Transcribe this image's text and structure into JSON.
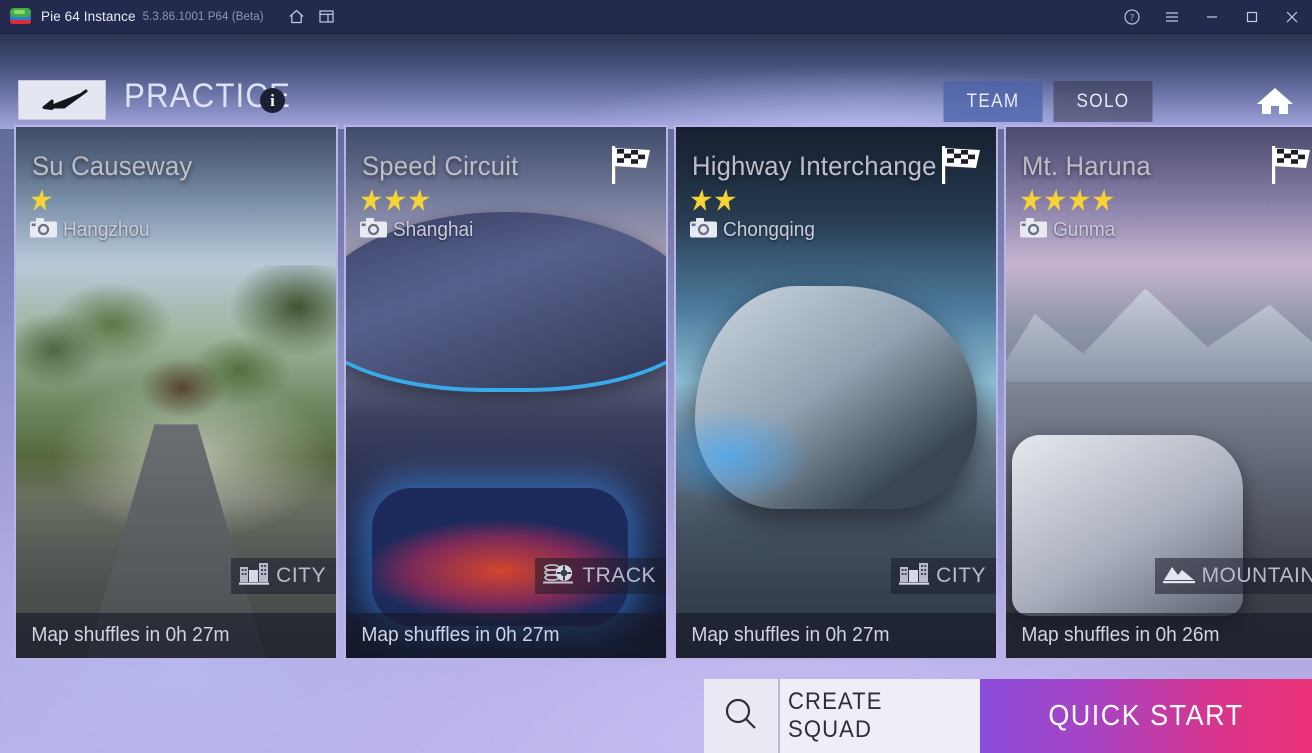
{
  "titlebar": {
    "app_name": "Pie 64 Instance",
    "version": "5.3.86.1001 P64 (Beta)",
    "icons": {
      "logo": "bluestacks-logo",
      "home": "home-icon",
      "multi_instance": "multi-instance-icon",
      "help": "help-icon",
      "menu": "hamburger-menu-icon",
      "minimize": "minimize-icon",
      "maximize": "maximize-icon",
      "close": "close-icon"
    }
  },
  "header": {
    "back_label": "back-arrow",
    "title": "PRACTICE",
    "info_label": "i",
    "tabs": [
      {
        "label": "TEAM",
        "active": true
      },
      {
        "label": "SOLO",
        "active": false
      }
    ],
    "home_label": "home-icon"
  },
  "cards": [
    {
      "title": "Su Causeway",
      "stars": 1,
      "location": "Hangzhou",
      "type": "CITY",
      "type_icon": "city-buildings-icon",
      "shuffle": "Map shuffles in 0h 27m",
      "has_flag": false,
      "art": "art-su"
    },
    {
      "title": "Speed Circuit",
      "stars": 3,
      "location": "Shanghai",
      "type": "TRACK",
      "type_icon": "tire-track-icon",
      "shuffle": "Map shuffles in 0h 27m",
      "has_flag": true,
      "art": "art-speed"
    },
    {
      "title": "Highway Interchange",
      "stars": 2,
      "location": "Chongqing",
      "type": "CITY",
      "type_icon": "city-buildings-icon",
      "shuffle": "Map shuffles in 0h 27m",
      "has_flag": true,
      "art": "art-hwy"
    },
    {
      "title": "Mt. Haruna",
      "stars": 4,
      "location": "Gunma",
      "type": "MOUNTAIN",
      "type_icon": "mountain-icon",
      "shuffle": "Map shuffles in 0h 26m",
      "has_flag": true,
      "art": "art-haruna"
    }
  ],
  "actions": {
    "search_label": "search-icon",
    "create_squad": "CREATE SQUAD",
    "quick_start": "QUICK START"
  },
  "colors": {
    "titlebar_bg": "#232a4d",
    "accent_purple": "#8a4ddb",
    "accent_pink": "#ec3276",
    "star_yellow": "#f5d434",
    "tab_active": "#4a61a8"
  }
}
